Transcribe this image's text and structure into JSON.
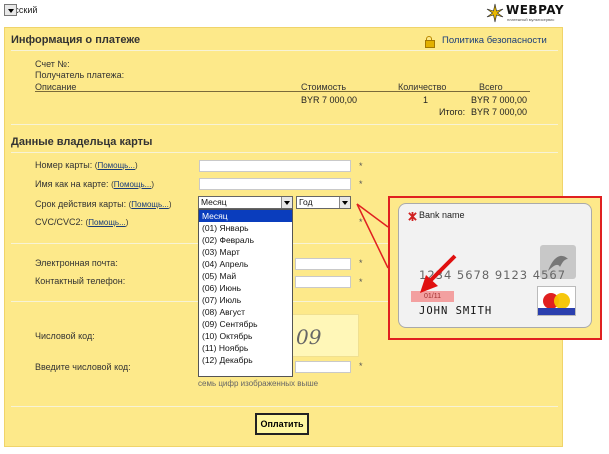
{
  "lang": {
    "selected": "Русский"
  },
  "logo": {
    "brand": "WEBPAY",
    "tagline": "платежный мультисервис"
  },
  "payment_info": {
    "title": "Информация о платеже",
    "privacy_link": "Политика безопасности",
    "labels": {
      "invoice": "Счет №:",
      "recipient": "Получатель платежа:"
    },
    "headers": {
      "description": "Описание",
      "price": "Стоимость",
      "qty": "Количество",
      "total": "Всего"
    },
    "row": {
      "price": "BYR 7 000,00",
      "qty": "1",
      "total": "BYR 7 000,00"
    },
    "grand_total": {
      "label": "Итого:",
      "value": "BYR 7 000,00"
    }
  },
  "cardholder": {
    "title": "Данные владельца карты",
    "help": "Помощь...",
    "fields": {
      "card_number": "Номер карты:",
      "card_name": "Имя как на карте:",
      "expiry": "Срок действия карты:",
      "cvc": "CVC/CVC2:",
      "email": "Электронная почта:",
      "phone": "Контактный телефон:",
      "numeric_code": "Числовой код:",
      "enter_code": "Введите числовой код:"
    },
    "asterisk": "*",
    "month_select": "Месяц",
    "year_select": "Год",
    "months": [
      "Месяц",
      "(01) Январь",
      "(02) Февраль",
      "(03) Март",
      "(04) Апрель",
      "(05) Май",
      "(06) Июнь",
      "(07) Июль",
      "(08) Август",
      "(09) Сентябрь",
      "(10) Октябрь",
      "(11) Ноябрь",
      "(12) Декабрь"
    ],
    "captcha_text": "09",
    "hint": "семь цифр изображенных выше",
    "pay_button": "Оплатить"
  },
  "card_sample": {
    "bank": "Bank name",
    "number": "1234 5678 9123 4567",
    "expiry": "01/11",
    "holder": "JOHN SMITH"
  }
}
